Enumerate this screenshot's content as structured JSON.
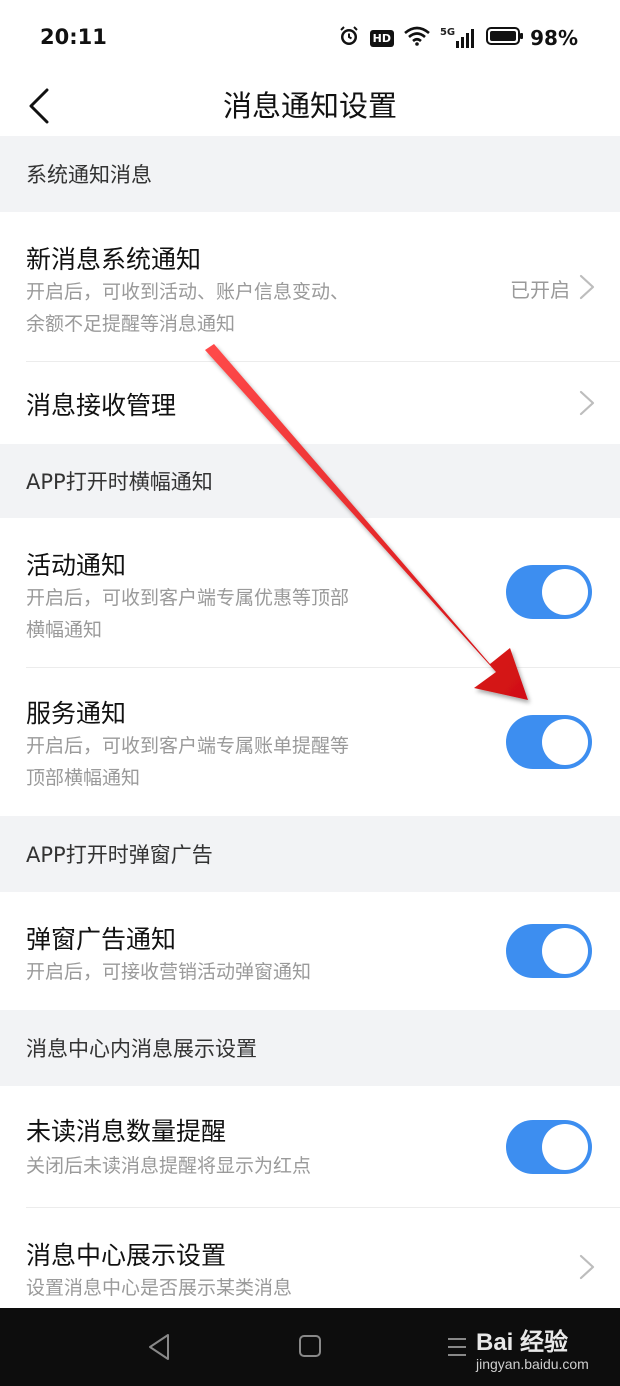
{
  "status_bar": {
    "time": "20:11",
    "hd": "HD",
    "net": "5G",
    "battery": "98%",
    "icons": [
      "alarm-icon",
      "hd-icon",
      "wifi-icon",
      "5g-signal-icon",
      "battery-icon"
    ]
  },
  "nav": {
    "title": "消息通知设置",
    "back_icon": "chevron-left-icon"
  },
  "sections": {
    "system": "系统通知消息",
    "banner": "APP打开时横幅通知",
    "popup": "APP打开时弹窗广告",
    "center": "消息中心内消息展示设置"
  },
  "rows": {
    "new_msg": {
      "title": "新消息系统通知",
      "desc_line1": "开启后，可收到活动、账户信息变动、",
      "desc_line2": "余额不足提醒等消息通知",
      "status": "已开启"
    },
    "receive_mgmt": {
      "title": "消息接收管理"
    },
    "activity": {
      "title": "活动通知",
      "desc_line1": "开启后，可收到客户端专属优惠等顶部",
      "desc_line2": "横幅通知",
      "enabled": true
    },
    "service": {
      "title": "服务通知",
      "desc_line1": "开启后，可收到客户端专属账单提醒等",
      "desc_line2": "顶部横幅通知",
      "enabled": true
    },
    "popup_ad": {
      "title": "弹窗广告通知",
      "desc_line1": "开启后，可接收营销活动弹窗通知",
      "enabled": true
    },
    "unread": {
      "title": "未读消息数量提醒",
      "desc_line1": "关闭后未读消息提醒将显示为红点",
      "enabled": true
    },
    "center_display": {
      "title": "消息中心展示设置",
      "desc_line1": "设置消息中心是否展示某类消息"
    }
  },
  "colors": {
    "toggle_on": "#3d8ef0",
    "section_bg": "#f2f3f5",
    "annotation_arrow": "#e3191c"
  },
  "watermark": {
    "main": "Bai 经验",
    "sub": "jingyan.baidu.com"
  }
}
